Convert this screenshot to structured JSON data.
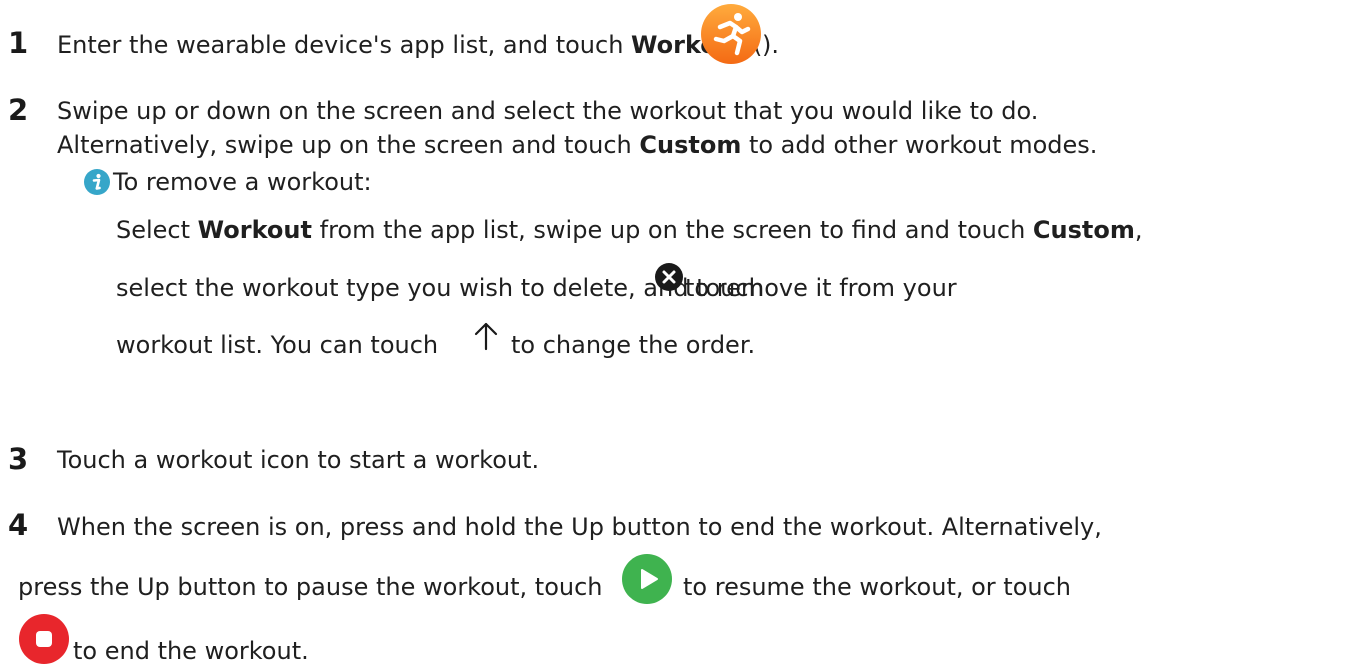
{
  "steps": [
    {
      "number": "1",
      "text_a": "Enter the wearable device's app list, and touch ",
      "bold_a": "Workout",
      "text_b": " (",
      "text_c": ")."
    },
    {
      "number": "2",
      "line1": "Swipe up or down on the screen and select the workout that you would like to do.",
      "line2_a": "Alternatively, swipe up on the screen and touch ",
      "line2_bold": "Custom",
      "line2_b": " to add other workout modes.",
      "note": {
        "title": "To remove a workout:",
        "l1_a": "Select ",
        "l1_bold1": "Workout",
        "l1_b": " from the app list, swipe up on the screen to find and touch ",
        "l1_bold2": "Custom",
        "l1_c": ",",
        "l2_a": "select the workout type you wish to delete, and touch ",
        "l2_b": " to remove it from your",
        "l3_a": "workout list. You can touch ",
        "l3_b": " to change the order."
      }
    },
    {
      "number": "3",
      "text": "Touch a workout icon to start a workout."
    },
    {
      "number": "4",
      "line1": "When the screen is on, press and hold the Up button to end the workout. Alternatively,",
      "line2_a": "press the Up button to pause the workout, touch ",
      "line2_b": " to resume the workout, or touch",
      "line3": "to end the workout."
    }
  ],
  "icons": {
    "workout": "running-person-icon",
    "info": "info-icon",
    "delete": "close-circle-icon",
    "move_up": "arrow-up-icon",
    "resume": "play-icon",
    "stop": "stop-icon"
  },
  "colors": {
    "workout_orange": "#f5821f",
    "info_teal": "#36a6c9",
    "play_green": "#3fb34f",
    "stop_red": "#e8262c",
    "delete_black": "#1a1a1a"
  }
}
